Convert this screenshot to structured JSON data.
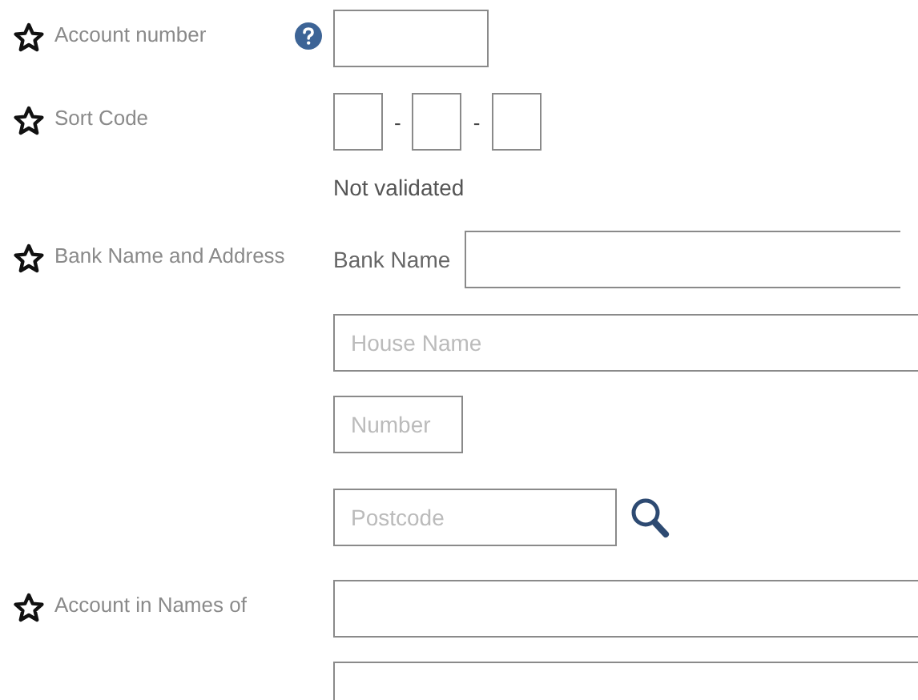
{
  "fields": [
    {
      "kind": "text",
      "label": "Account number",
      "required": true,
      "help": true
    },
    {
      "kind": "sort_code",
      "label": "Sort Code",
      "required": true,
      "help": false,
      "separators": [
        "-",
        "-"
      ],
      "status": "Not validated"
    },
    {
      "kind": "address",
      "label": "Bank Name and Address",
      "required": true,
      "help": false,
      "bank_name_label": "Bank Name",
      "placeholders": [
        "House Name",
        "Number",
        "Postcode"
      ]
    },
    {
      "kind": "names",
      "label": "Account in Names of",
      "required": true,
      "help": false
    }
  ]
}
